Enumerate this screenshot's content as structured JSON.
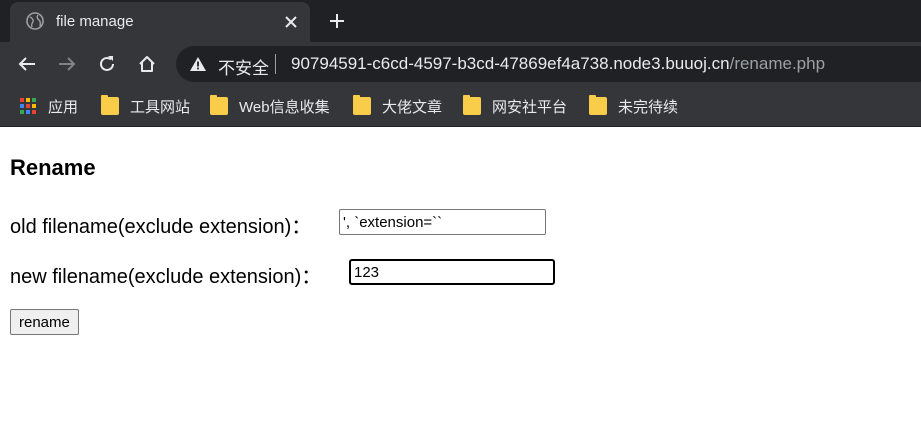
{
  "browser": {
    "tab": {
      "title": "file manage",
      "globe_icon": "globe-icon",
      "close_icon": "close-icon"
    },
    "new_tab_icon": "plus-icon",
    "nav": {
      "back_icon": "arrow-left-icon",
      "forward_icon": "arrow-right-icon",
      "reload_icon": "reload-icon",
      "home_icon": "home-icon"
    },
    "omnibox": {
      "security_label": "不安全",
      "host": "90794591-c6cd-4597-b3cd-47869ef4a738.node3.buuoj.cn",
      "path": "/rename.php"
    },
    "bookmarks": [
      {
        "label": "应用",
        "icon": "apps-grid-icon"
      },
      {
        "label": "工具网站",
        "icon": "folder-icon"
      },
      {
        "label": "Web信息收集",
        "icon": "folder-icon"
      },
      {
        "label": "大佬文章",
        "icon": "folder-icon"
      },
      {
        "label": "网安社平台",
        "icon": "folder-icon"
      },
      {
        "label": "未完待续",
        "icon": "folder-icon"
      }
    ]
  },
  "page": {
    "heading": "Rename",
    "old_label": "old filename(exclude extension)：",
    "old_value": "', `extension=``",
    "new_label": "new filename(exclude extension)：",
    "new_value": "123",
    "submit_label": "rename"
  },
  "colors": {
    "chrome_dark": "#202124",
    "chrome_mid": "#35363a",
    "chrome_text": "#e8eaed",
    "chrome_muted": "#9aa0a6",
    "folder": "#f9cc49"
  }
}
